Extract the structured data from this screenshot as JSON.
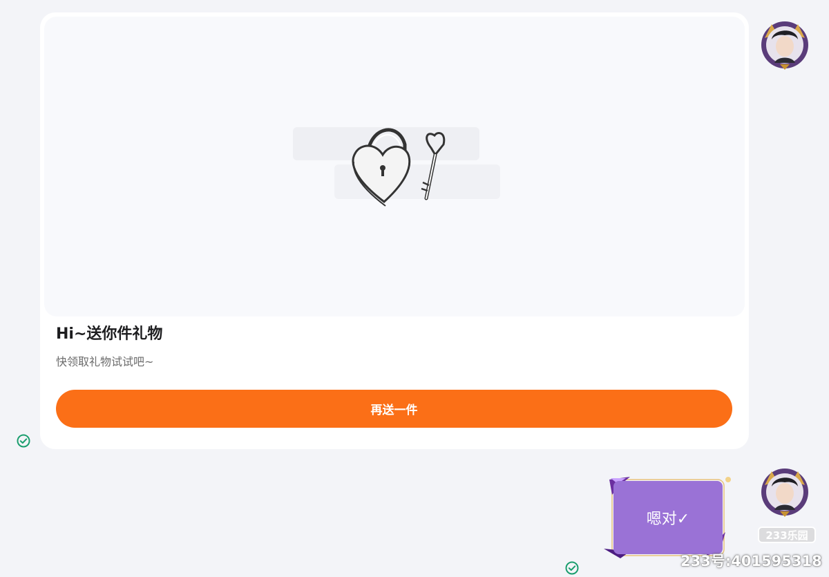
{
  "gift_card": {
    "image_label": "gift-lock-and-key-illustration",
    "title": "Hi~送你件礼物",
    "subtitle": "快领取礼物试试吧~",
    "button_label": "再送一件"
  },
  "message": {
    "text": "嗯对✓"
  },
  "status_icons": [
    "sent-check-icon",
    "sent-check-icon"
  ],
  "watermark": {
    "logo": "233乐园",
    "id_text": "233号:401595318"
  },
  "colors": {
    "accent_button": "#fb6f17",
    "bubble": "#9a72d6",
    "check": "#1a9e6e"
  }
}
